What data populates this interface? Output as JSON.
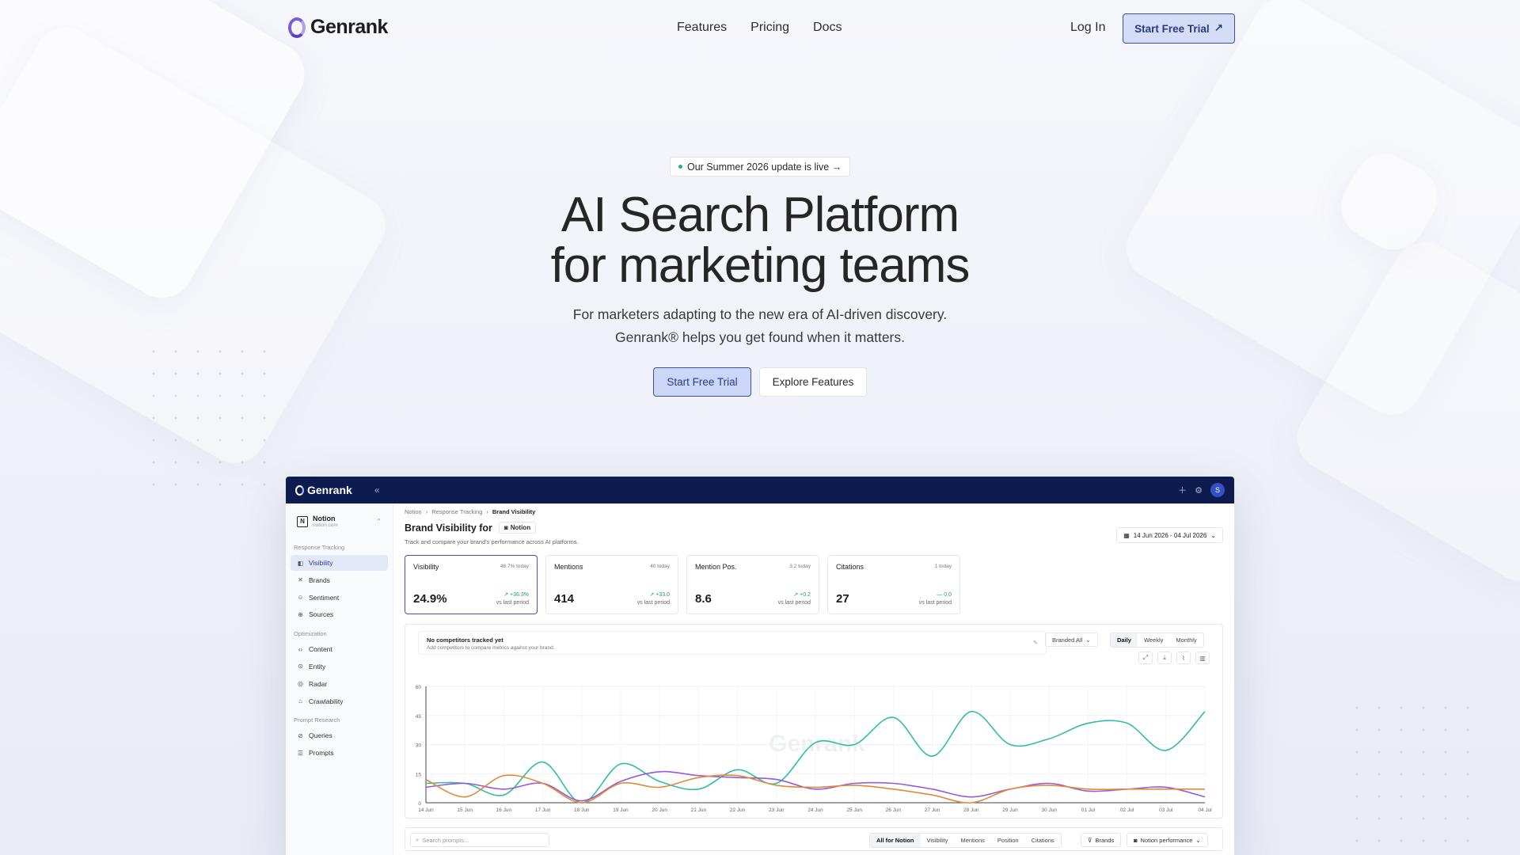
{
  "nav": {
    "brand": "Genrank",
    "links": [
      "Features",
      "Pricing",
      "Docs"
    ],
    "login": "Log In",
    "cta": "Start Free Trial"
  },
  "hero": {
    "badge": "Our Summer 2026 update is live →",
    "title_line1": "AI Search Platform",
    "title_line2": "for marketing teams",
    "subtitle_line1": "For marketers adapting to the new era of AI-driven discovery.",
    "subtitle_line2": "Genrank® helps you get found when it matters.",
    "primary_cta": "Start Free Trial",
    "secondary_cta": "Explore Features"
  },
  "app": {
    "brand": "Genrank",
    "collapse": "«",
    "top_icons": [
      "plus-icon",
      "gear-icon"
    ],
    "avatar": "S",
    "workspace": {
      "name": "Notion",
      "domain": "notion.com",
      "initial": "N"
    },
    "sections": [
      {
        "title": "Response Tracking",
        "items": [
          {
            "label": "Visibility",
            "icon": "◧",
            "active": true
          },
          {
            "label": "Brands",
            "icon": "✕",
            "active": false
          },
          {
            "label": "Sentiment",
            "icon": "☺",
            "active": false
          },
          {
            "label": "Sources",
            "icon": "⊕",
            "active": false
          }
        ]
      },
      {
        "title": "Optimization",
        "items": [
          {
            "label": "Content",
            "icon": "‹›",
            "active": false
          },
          {
            "label": "Entity",
            "icon": "⊙",
            "active": false
          },
          {
            "label": "Radar",
            "icon": "◎",
            "active": false
          },
          {
            "label": "Crawlability",
            "icon": "⌂",
            "active": false
          }
        ]
      },
      {
        "title": "Prompt Research",
        "items": [
          {
            "label": "Queries",
            "icon": "⊘",
            "active": false
          },
          {
            "label": "Prompts",
            "icon": "☰",
            "active": false
          }
        ]
      }
    ],
    "breadcrumb": [
      "Notion",
      "Response Tracking",
      "Brand Visibility"
    ],
    "page_title": "Brand Visibility for",
    "page_chip": "Notion",
    "description": "Track and compare your brand's performance across AI platforms.",
    "date_range": "14 Jun 2026 - 04 Jul 2026",
    "kpis": [
      {
        "name": "Visibility",
        "today": "46.7% today",
        "value": "24.9%",
        "delta": "↗ +36.3%",
        "vs": "vs last period",
        "active": true
      },
      {
        "name": "Mentions",
        "today": "40 today",
        "value": "414",
        "delta": "↗ +33.0",
        "vs": "vs last period",
        "active": false
      },
      {
        "name": "Mention Pos.",
        "today": "3.2 today",
        "value": "8.6",
        "delta": "↗ +0.2",
        "vs": "vs last period",
        "active": false
      },
      {
        "name": "Citations",
        "today": "1 today",
        "value": "27",
        "delta": "— 0.0",
        "vs": "vs last period",
        "active": false
      }
    ],
    "notice_title": "No competitors tracked yet",
    "notice_sub": "Add competitors to compare metrics against your brand.",
    "branded_filter": "Branded  All",
    "periods": [
      "Daily",
      "Weekly",
      "Monthly"
    ],
    "active_period": "Daily",
    "watermark": "Genrank",
    "search_placeholder": "Search prompts...",
    "filters": [
      "All for Notion",
      "Visibility",
      "Mentions",
      "Position",
      "Citations"
    ],
    "brands_btn": "Brands",
    "perf_btn": "Notion performance"
  },
  "chart_data": {
    "type": "line",
    "ylim": [
      0,
      60
    ],
    "yticks": [
      0,
      15,
      30,
      45,
      60
    ],
    "categories": [
      "14 Jun",
      "15 Jun",
      "16 Jun",
      "17 Jun",
      "18 Jun",
      "19 Jun",
      "20 Jun",
      "21 Jun",
      "22 Jun",
      "23 Jun",
      "24 Jun",
      "25 Jun",
      "26 Jun",
      "27 Jun",
      "28 Jun",
      "29 Jun",
      "30 Jun",
      "01 Jul",
      "02 Jul",
      "03 Jul",
      "04 Jul"
    ],
    "series": [
      {
        "color": "#2fbf9f",
        "values": [
          10,
          10,
          4,
          21,
          0,
          20,
          11,
          7,
          17,
          10,
          31,
          30,
          44,
          24,
          47,
          30,
          33,
          41,
          41,
          27,
          47
        ]
      },
      {
        "color": "#9a5ad3",
        "values": [
          8,
          10,
          7,
          10,
          1,
          11,
          16,
          14,
          13,
          12,
          7,
          10,
          10,
          7,
          3,
          7,
          10,
          6,
          7,
          8,
          3
        ]
      },
      {
        "color": "#e08a3a",
        "values": [
          12,
          3,
          14,
          10,
          0,
          10,
          8,
          13,
          14,
          9,
          8,
          9,
          7,
          4,
          0,
          7,
          9,
          7,
          7,
          7,
          7
        ]
      }
    ]
  }
}
